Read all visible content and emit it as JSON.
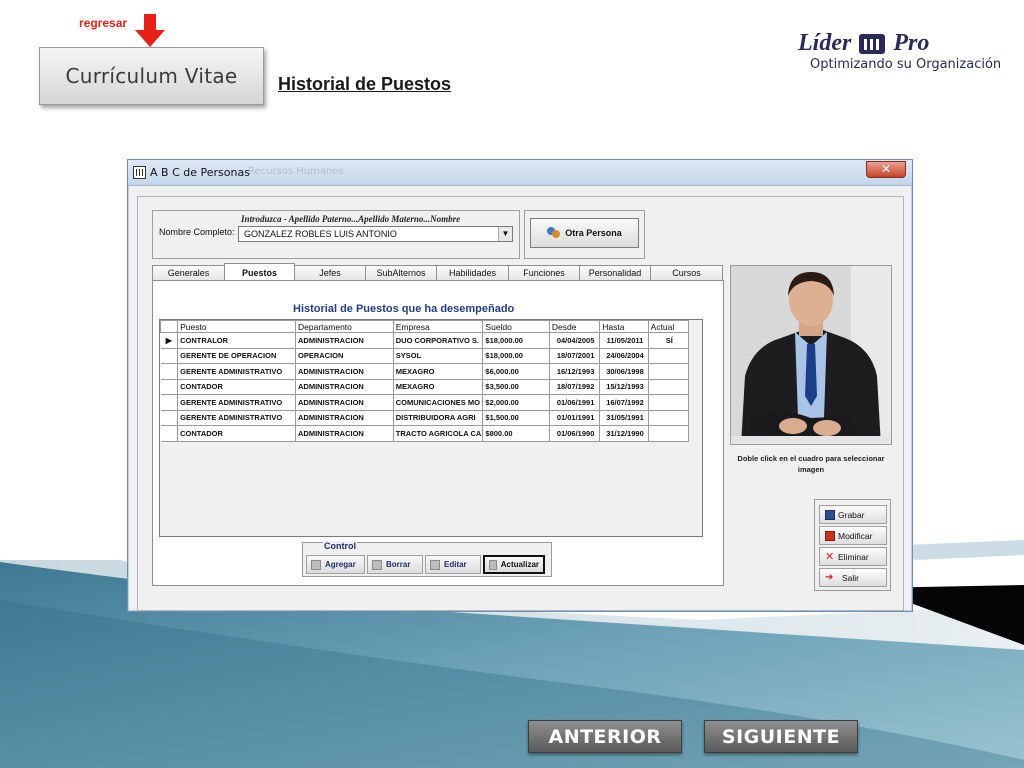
{
  "header": {
    "back_link": "regresar",
    "section_button": "Currículum Vitae",
    "page_title": "Historial de Puestos"
  },
  "logo": {
    "word1": "Líder",
    "word2": "Pro",
    "tagline": "Optimizando su Organización"
  },
  "window": {
    "title": "A B C de Personas",
    "ghost_title": "Recursos Humanos",
    "close": "✕",
    "name_hint": "Introduzca - Apellido Paterno...Apellido Materno...Nombre",
    "name_label": "Nombre Completo:",
    "name_value": "GONZALEZ ROBLES LUIS ANTONIO",
    "otra_persona": "Otra Persona",
    "tabs": [
      "Generales",
      "Puestos",
      "Jefes",
      "SubAlternos",
      "Habilidades",
      "Funciones",
      "Personalidad",
      "Cursos"
    ],
    "active_tab": "Puestos",
    "panel_title": "Historial de Puestos que ha desempeñado",
    "columns": [
      "Puesto",
      "Departamento",
      "Empresa",
      "Sueldo",
      "Desde",
      "Hasta",
      "Actual"
    ],
    "rows": [
      [
        "CONTRALOR",
        "ADMINISTRACION",
        "DUO CORPORATIVO S.",
        "$18,000.00",
        "04/04/2005",
        "11/05/2011",
        "SÍ"
      ],
      [
        "GERENTE DE OPERACION",
        "OPERACION",
        "SYSOL",
        "$18,000.00",
        "18/07/2001",
        "24/06/2004",
        ""
      ],
      [
        "GERENTE ADMINISTRATIVO",
        "ADMINISTRACION",
        "MEXAGRO",
        "$6,000.00",
        "16/12/1993",
        "30/06/1998",
        ""
      ],
      [
        "CONTADOR",
        "ADMINISTRACION",
        "MEXAGRO",
        "$3,500.00",
        "18/07/1992",
        "15/12/1993",
        ""
      ],
      [
        "GERENTE ADMINISTRATIVO",
        "ADMINISTRACION",
        "COMUNICACIONES MO",
        "$2,000.00",
        "01/06/1991",
        "16/07/1992",
        ""
      ],
      [
        "GERENTE ADMINISTRATIVO",
        "ADMINISTRACION",
        "DISTRIBUIDORA AGRI",
        "$1,500.00",
        "01/01/1991",
        "31/05/1991",
        ""
      ],
      [
        "CONTADOR",
        "ADMINISTRACION",
        "TRACTO AGRICOLA CA",
        "$800.00",
        "01/06/1990",
        "31/12/1990",
        ""
      ]
    ],
    "control": {
      "title": "Control",
      "agregar": "Agregar",
      "borrar": "Borrar",
      "editar": "Editar",
      "actualizar": "Actualizar"
    },
    "photo_hint": "Doble click en el cuadro para seleccionar imagen",
    "actions": {
      "grabar": "Grabar",
      "modificar": "Modificar",
      "eliminar": "Eliminar",
      "salir": "Salir"
    }
  },
  "nav": {
    "prev": "ANTERIOR",
    "next": "SIGUIENTE"
  },
  "colors": {
    "accent_red": "#e8201a",
    "brand_navy": "#2a2a55",
    "grid_title_blue": "#243d82",
    "wave_teal": "#4f8aa3"
  }
}
